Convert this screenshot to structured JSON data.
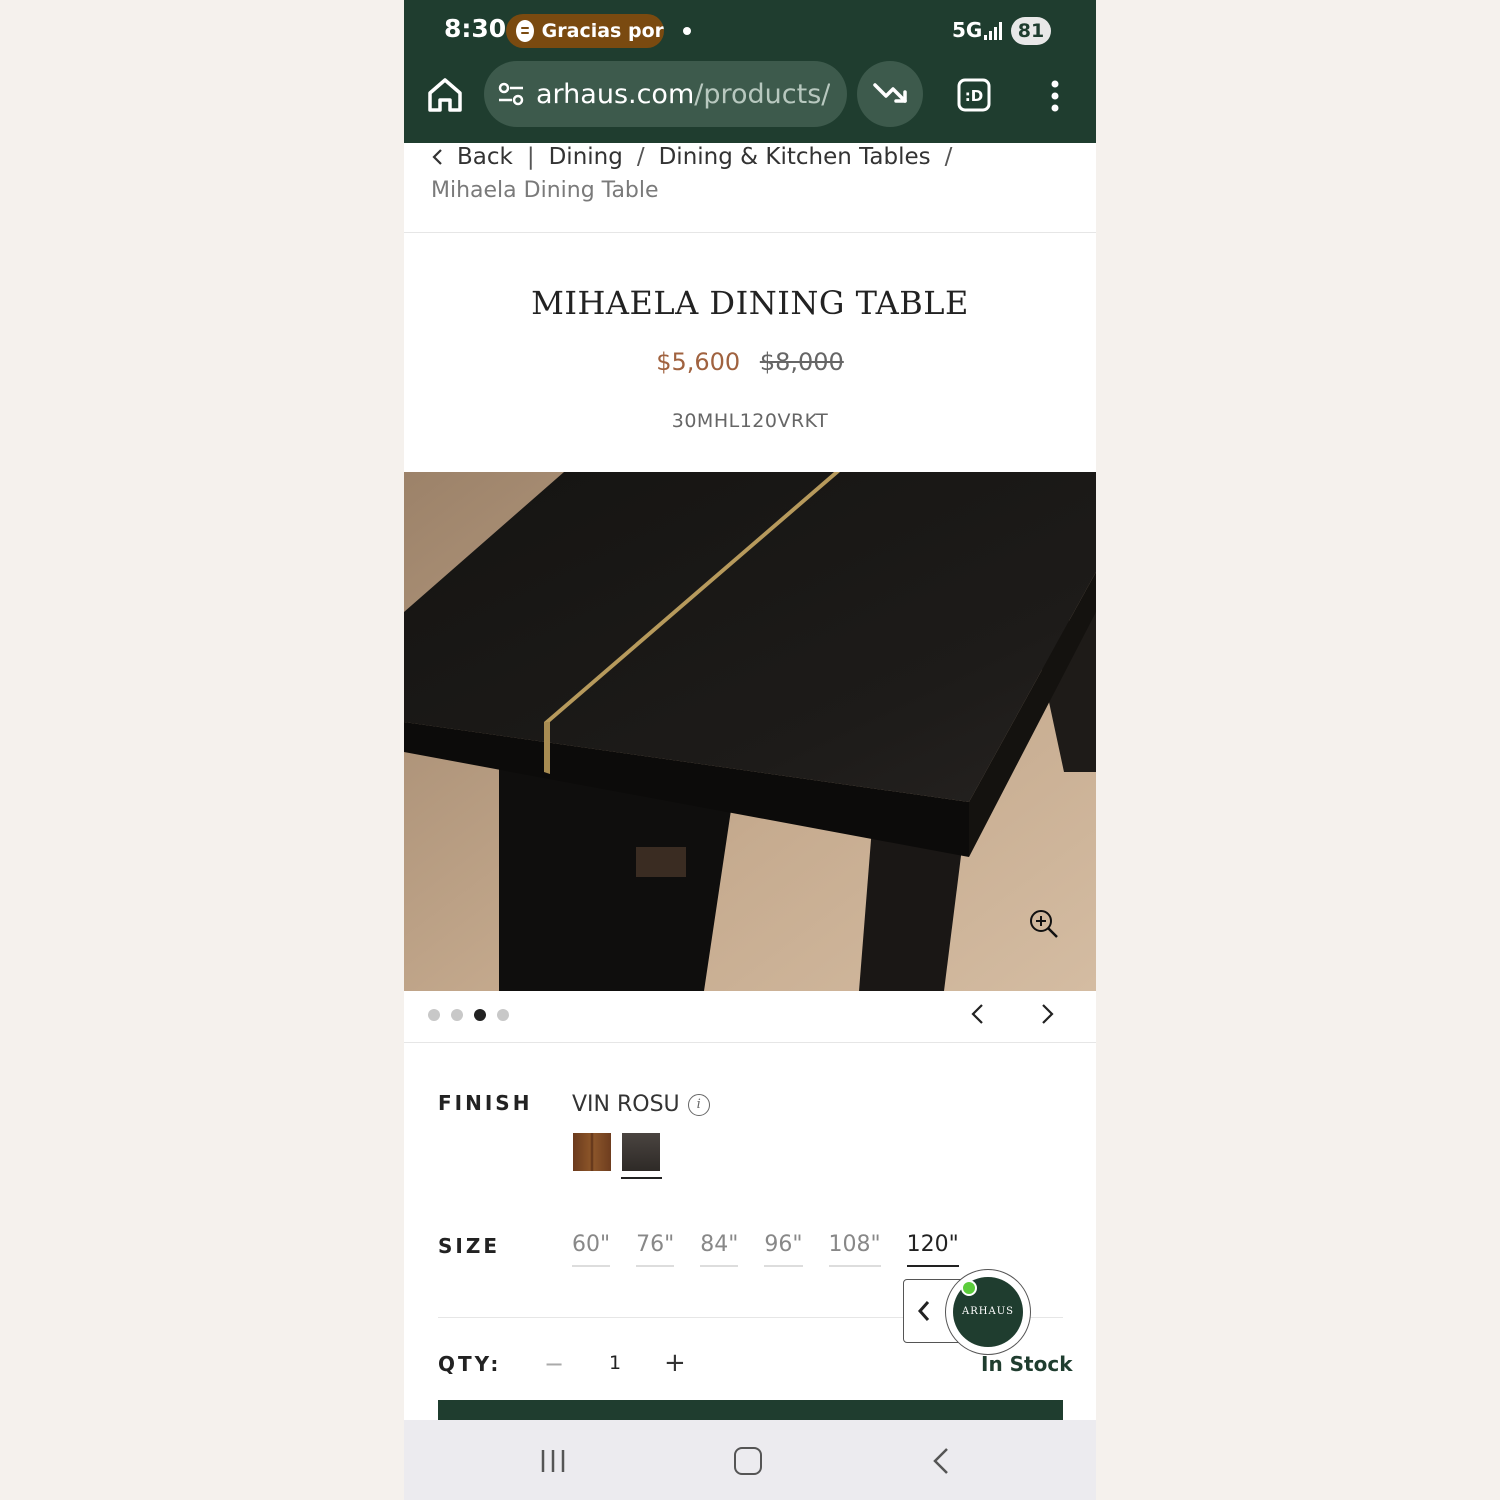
{
  "status_bar": {
    "time": "8:30",
    "media_text": "Gracias por",
    "network": "5G",
    "battery": "81"
  },
  "browser": {
    "url_domain": "arhaus.com",
    "url_path": "/products/"
  },
  "breadcrumb": {
    "back": "Back",
    "separator_pipe": "|",
    "separator_slash": "/",
    "items": [
      "Dining",
      "Dining & Kitchen Tables"
    ],
    "current": "Mihaela Dining Table"
  },
  "product": {
    "title": "MIHAELA DINING TABLE",
    "price_sale": "$5,600",
    "price_original": "$8,000",
    "sku": "30MHL120VRKT"
  },
  "gallery": {
    "total_images": 4,
    "active_index": 3
  },
  "options": {
    "finish_label": "FINISH",
    "finish_value": "VIN ROSU",
    "info_glyph": "i",
    "size_label": "SIZE",
    "sizes": [
      "60\"",
      "76\"",
      "84\"",
      "96\"",
      "108\"",
      "120\""
    ],
    "selected_size": "120\"",
    "qty_label": "QTY:",
    "qty_minus": "−",
    "qty_value": "1",
    "qty_plus": "+",
    "stock_status": "In Stock"
  },
  "chat": {
    "brand": "ARHAUS"
  },
  "colors": {
    "brand_green": "#1f3d2f",
    "sale_price": "#a0623f",
    "online": "#5ccd3c"
  }
}
